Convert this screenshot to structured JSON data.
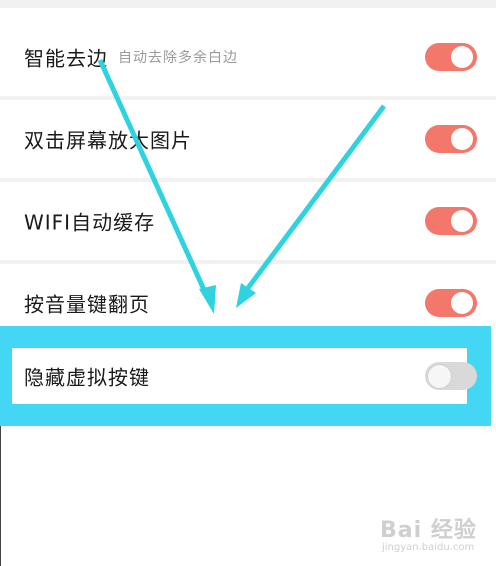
{
  "settings": [
    {
      "label": "智能去边",
      "sublabel": "自动去除多余白边",
      "enabled": true
    },
    {
      "label": "双击屏幕放大图片",
      "sublabel": "",
      "enabled": true
    },
    {
      "label": "WIFI自动缓存",
      "sublabel": "",
      "enabled": true
    },
    {
      "label": "按音量键翻页",
      "sublabel": "",
      "enabled": true
    },
    {
      "label": "隐藏虚拟按键",
      "sublabel": "",
      "enabled": false
    }
  ],
  "colors": {
    "toggle_on": "#f4776b",
    "toggle_off": "#d9d9d9",
    "highlight": "#44d7f3",
    "arrow": "#2ed3df"
  },
  "watermark": {
    "main": "Bai 经验",
    "sub": "jingyan.baidu.com"
  }
}
